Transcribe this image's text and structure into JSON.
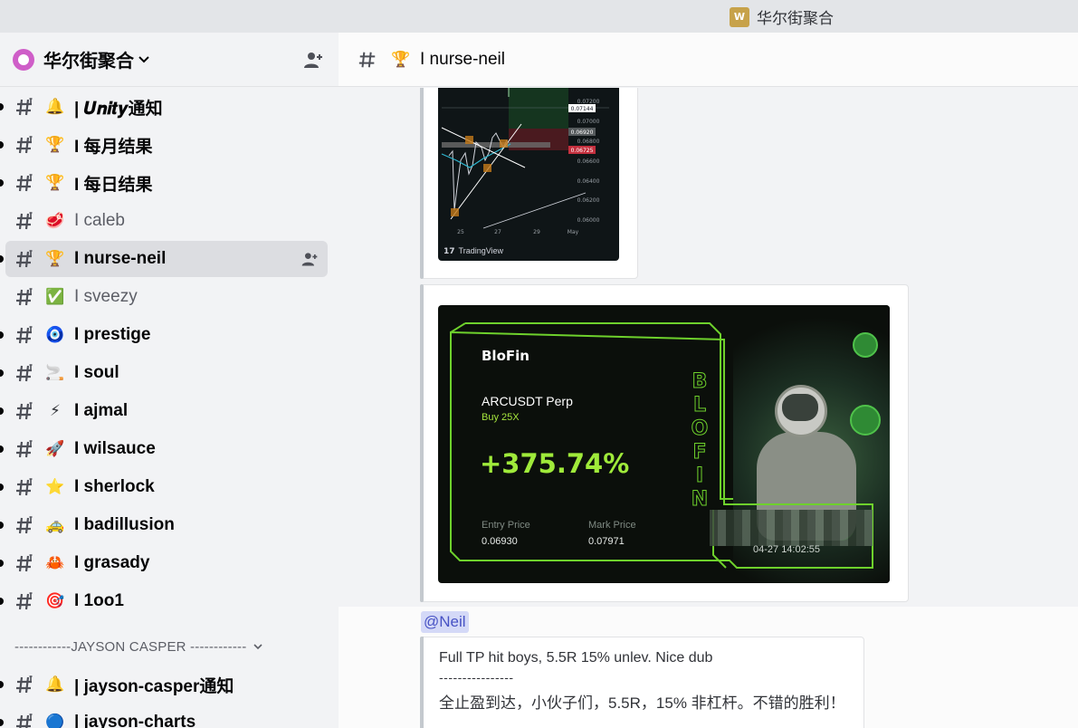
{
  "titlebar": {
    "app_title": "华尔街聚合",
    "logo_icon": "wallstreet-logo"
  },
  "server": {
    "name": "华尔街聚合"
  },
  "channels": [
    {
      "emoji": "🔔",
      "name": "| 𝑼𝒏𝒊𝒕𝒚通知",
      "unread": true,
      "muted": false
    },
    {
      "emoji": "🏆",
      "name": "I 每月结果",
      "unread": true,
      "muted": false
    },
    {
      "emoji": "🏆",
      "name": "I 每日结果",
      "unread": true,
      "muted": false
    },
    {
      "emoji": "🥩",
      "name": "I caleb",
      "unread": false,
      "muted": true
    },
    {
      "emoji": "🏆",
      "name": "I nurse-neil",
      "unread": true,
      "muted": false,
      "active": true
    },
    {
      "emoji": "✅",
      "name": "I sveezy",
      "unread": false,
      "muted": true
    },
    {
      "emoji": "🧿",
      "name": "I prestige",
      "unread": true,
      "muted": false
    },
    {
      "emoji": "🚬",
      "name": "I soul",
      "unread": true,
      "muted": false
    },
    {
      "emoji": "⚡",
      "name": "I ajmal",
      "unread": true,
      "muted": false
    },
    {
      "emoji": "🚀",
      "name": "I wilsauce",
      "unread": true,
      "muted": false
    },
    {
      "emoji": "⭐",
      "name": "I sherlock",
      "unread": true,
      "muted": false
    },
    {
      "emoji": "🚕",
      "name": "I badillusion",
      "unread": true,
      "muted": false
    },
    {
      "emoji": "🦀",
      "name": "I grasady",
      "unread": true,
      "muted": false
    },
    {
      "emoji": "🎯",
      "name": "I 1oo1",
      "unread": true,
      "muted": false
    }
  ],
  "category": {
    "label": "------------JAYSON CASPER ------------"
  },
  "channels2": [
    {
      "emoji": "🔔",
      "name": "| jayson-casper通知",
      "unread": true
    },
    {
      "emoji": "🔵",
      "name": "| jayson-charts",
      "unread": true
    }
  ],
  "header": {
    "emoji": "🏆",
    "channel_name": "I nurse-neil"
  },
  "chart_image": {
    "price_labels": [
      "0.07200",
      "0.07144",
      "0.07000",
      "0.06920",
      "0.06800",
      "0.06725",
      "0.06600",
      "0.06400",
      "0.06200",
      "0.06000"
    ],
    "x_labels": [
      "25",
      "27",
      "29",
      "May"
    ],
    "watermark": "TradingView"
  },
  "blofin": {
    "brand": "BloFin",
    "pair": "ARCUSDT Perp",
    "side": "Buy  25X",
    "roi": "+375.74%",
    "entry_label": "Entry Price",
    "entry_value": "0.06930",
    "mark_label": "Mark Price",
    "mark_value": "0.07971",
    "timestamp": "04-27 14:02:55",
    "vertical_text": "BLOFIN"
  },
  "message": {
    "mention": "@Neil",
    "line1": "Full TP hit boys, 5.5R 15% unlev. Nice dub",
    "line2": "----------------",
    "line3": "全止盈到达，小伙子们，5.5R，15% 非杠杆。不错的胜利！"
  },
  "colors": {
    "accent_green": "#9fea3a",
    "mention_bg": "#d4d9f7",
    "mention_text": "#4752c4"
  }
}
